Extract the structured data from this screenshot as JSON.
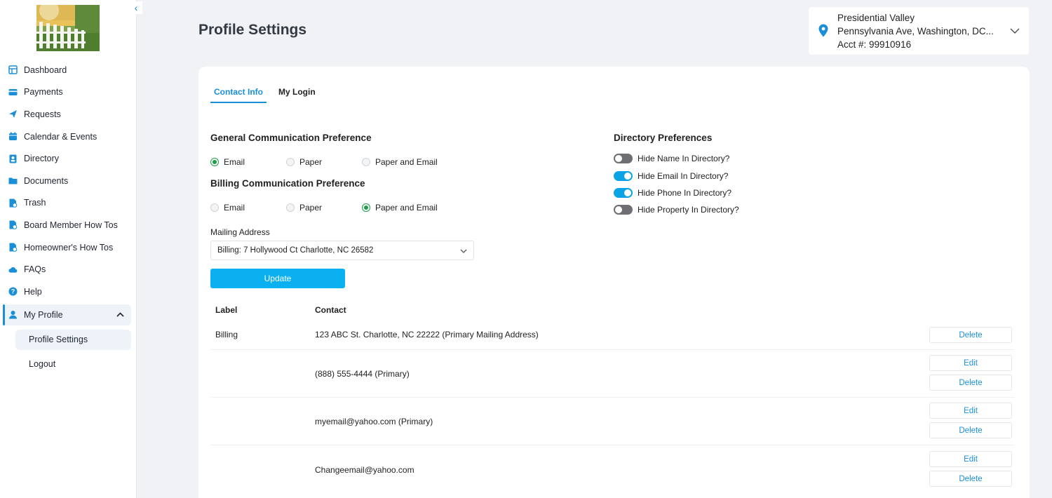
{
  "sidebar": {
    "items": [
      {
        "label": "Dashboard",
        "icon": "dashboard-icon"
      },
      {
        "label": "Payments",
        "icon": "credit-card-icon"
      },
      {
        "label": "Requests",
        "icon": "send-icon"
      },
      {
        "label": "Calendar & Events",
        "icon": "calendar-icon"
      },
      {
        "label": "Directory",
        "icon": "contacts-icon"
      },
      {
        "label": "Documents",
        "icon": "folder-icon"
      },
      {
        "label": "Trash",
        "icon": "document-icon"
      },
      {
        "label": "Board Member How Tos",
        "icon": "document-icon"
      },
      {
        "label": "Homeowner's How Tos",
        "icon": "document-icon"
      },
      {
        "label": "FAQs",
        "icon": "cloud-icon"
      },
      {
        "label": "Help",
        "icon": "help-icon"
      }
    ],
    "active": {
      "label": "My Profile",
      "icon": "user-icon"
    },
    "sub_items": [
      {
        "label": "Profile Settings"
      },
      {
        "label": "Logout"
      }
    ],
    "accent": "#1a8fd8"
  },
  "header": {
    "title": "Profile Settings"
  },
  "account": {
    "name": "Presidential Valley",
    "address": "Pennsylvania Ave, Washington, DC...",
    "acct": "Acct #: 99910916"
  },
  "tabs": [
    {
      "label": "Contact Info",
      "active": true
    },
    {
      "label": "My Login",
      "active": false
    }
  ],
  "general_pref": {
    "title": "General Communication Preference",
    "options": [
      "Email",
      "Paper",
      "Paper and Email"
    ],
    "selected": "Email"
  },
  "billing_pref": {
    "title": "Billing Communication Preference",
    "options": [
      "Email",
      "Paper",
      "Paper and Email"
    ],
    "selected": "Paper and Email"
  },
  "mailing": {
    "label": "Mailing Address",
    "value": "Billing: 7 Hollywood Ct Charlotte, NC 26582"
  },
  "update_label": "Update",
  "directory": {
    "title": "Directory Preferences",
    "items": [
      {
        "label": "Hide Name In Directory?",
        "on": false
      },
      {
        "label": "Hide Email In Directory?",
        "on": true
      },
      {
        "label": "Hide Phone In Directory?",
        "on": true
      },
      {
        "label": "Hide Property In Directory?",
        "on": false
      }
    ]
  },
  "contacts": {
    "headers": {
      "label": "Label",
      "contact": "Contact"
    },
    "edit_label": "Edit",
    "delete_label": "Delete",
    "rows": [
      {
        "label": "Billing",
        "contact": "123 ABC St. Charlotte, NC 22222 (Primary Mailing Address)"
      },
      {
        "label": "",
        "contact": "(888) 555-4444 (Primary)"
      },
      {
        "label": "",
        "contact": "myemail@yahoo.com (Primary)"
      },
      {
        "label": "",
        "contact": "Changeemail@yahoo.com"
      }
    ]
  }
}
